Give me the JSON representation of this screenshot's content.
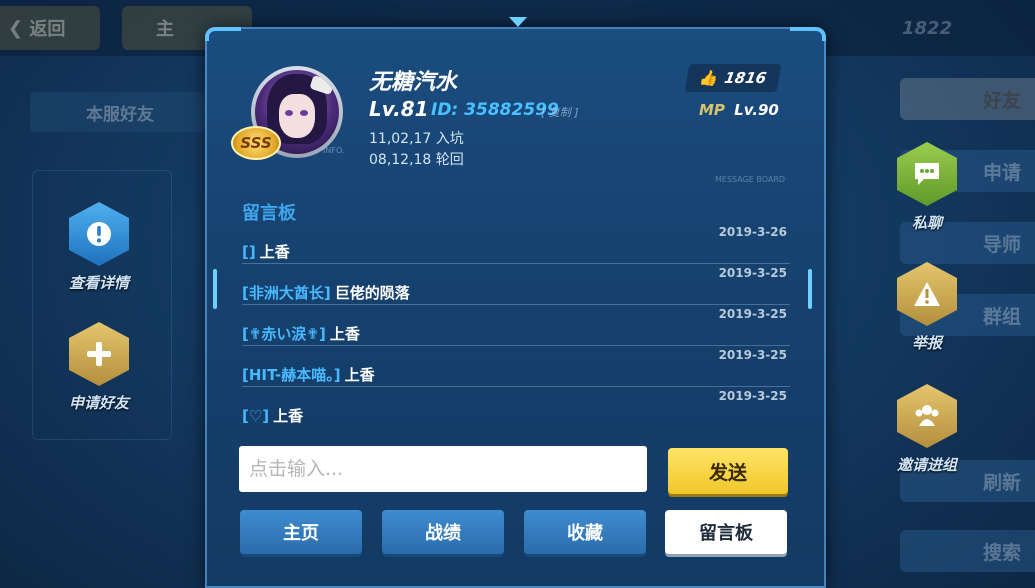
{
  "background": {
    "back_label": "返回",
    "home_label": "主",
    "stats": [
      "1822"
    ],
    "server_friends": "本服好友",
    "right_tabs": [
      "好友",
      "申请",
      "导师",
      "群组",
      "刷新",
      "搜索"
    ]
  },
  "left_actions": [
    {
      "label": "查看详情",
      "icon": "info-icon"
    },
    {
      "label": "申请好友",
      "icon": "plus-icon"
    }
  ],
  "right_actions": [
    {
      "label": "私聊",
      "icon": "chat-icon"
    },
    {
      "label": "举报",
      "icon": "warning-icon"
    },
    {
      "label": "邀请进组",
      "icon": "group-icon"
    }
  ],
  "profile": {
    "name": "无糖汽水",
    "level": "Lv.81",
    "id_label": "ID:",
    "id_value": "35882599",
    "copy_label": "[ 复制 ]",
    "joined": "11,02,17 入坑",
    "reincarnation": "08,12,18 轮回",
    "rank_badge": "SSS",
    "info_tag": "INFO.",
    "likes": "1816",
    "mp_label": "MP",
    "mp_level": "Lv.90"
  },
  "board": {
    "title": "留言板",
    "title_en": "MESSAGE BOARD",
    "messages": [
      {
        "user": "[]",
        "text": "上香",
        "date": "2019-3-26"
      },
      {
        "user": "[非洲大酋长]",
        "text": "巨佬的陨落",
        "date": "2019-3-25"
      },
      {
        "user": "[✟赤い涙✟]",
        "text": "上香",
        "date": "2019-3-25"
      },
      {
        "user": "[HIT-赫本喵。]",
        "text": "上香",
        "date": "2019-3-25"
      },
      {
        "user": "[♡]",
        "text": "上香",
        "date": "2019-3-25"
      }
    ]
  },
  "composer": {
    "placeholder": "点击输入...",
    "send_label": "发送"
  },
  "tabs": [
    {
      "label": "主页",
      "active": false
    },
    {
      "label": "战绩",
      "active": false
    },
    {
      "label": "收藏",
      "active": false
    },
    {
      "label": "留言板",
      "active": true
    }
  ],
  "colors": {
    "accent_blue": "#49b9ff",
    "send_yellow": "#f0c72a",
    "tab_blue": "#2a6cab"
  }
}
